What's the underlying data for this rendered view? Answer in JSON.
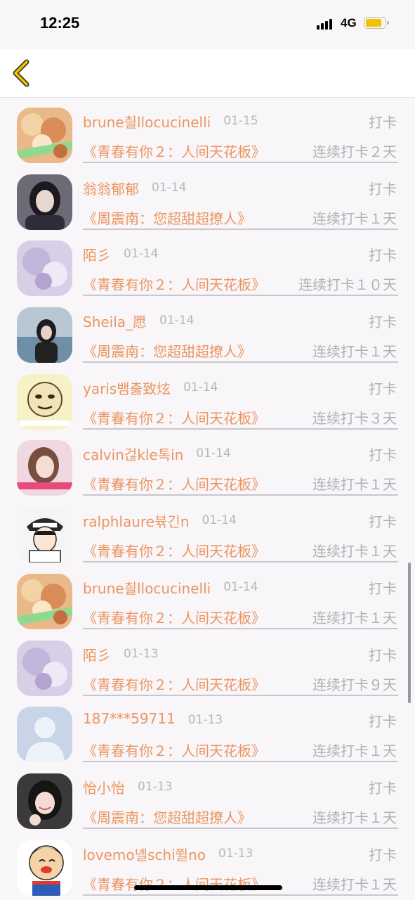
{
  "status_bar": {
    "time": "12:25",
    "network": "4G"
  },
  "nav": {
    "back_icon": "chevron-left-icon",
    "accent": "#f2c200"
  },
  "colors": {
    "name": "#ec9560",
    "muted": "#b3b0b4"
  },
  "entries": [
    {
      "name": "brune칄llocucinelli",
      "date": "01-15",
      "action": "打卡",
      "book": "《青春有你２：人间天花板》",
      "streak": "连续打卡２天",
      "avatar": "flowers"
    },
    {
      "name": "翁翁郁郁",
      "date": "01-14",
      "action": "打卡",
      "book": "《周震南：您超甜超撩人》",
      "streak": "连续打卡１天",
      "avatar": "girl-dark"
    },
    {
      "name": "陌彡",
      "date": "01-14",
      "action": "打卡",
      "book": "《青春有你２：人间天花板》",
      "streak": "连续打卡１０天",
      "avatar": "lilac"
    },
    {
      "name": "Sheila_愿",
      "date": "01-14",
      "action": "打卡",
      "book": "《周震南：您超甜超撩人》",
      "streak": "连续打卡１天",
      "avatar": "girl-sea"
    },
    {
      "name": "yaris뱀춣致炫",
      "date": "01-14",
      "action": "打卡",
      "book": "《青春有你２：人间天花板》",
      "streak": "连续打卡３天",
      "avatar": "meme"
    },
    {
      "name": "calvin걶kle톡in",
      "date": "01-14",
      "action": "打卡",
      "book": "《青春有你２：人间天花板》",
      "streak": "连续打卡１天",
      "avatar": "girl-pink"
    },
    {
      "name": "ralphlaure뷲긴n",
      "date": "01-14",
      "action": "打卡",
      "book": "《青春有你２：人间天花板》",
      "streak": "连续打卡１天",
      "avatar": "anime"
    },
    {
      "name": "brune칄llocucinelli",
      "date": "01-14",
      "action": "打卡",
      "book": "《青春有你２：人间天花板》",
      "streak": "连续打卡１天",
      "avatar": "flowers"
    },
    {
      "name": "陌彡",
      "date": "01-13",
      "action": "打卡",
      "book": "《青春有你２：人间天花板》",
      "streak": "连续打卡９天",
      "avatar": "lilac"
    },
    {
      "name": "187***59711",
      "date": "01-13",
      "action": "打卡",
      "book": "《青春有你２：人间天花板》",
      "streak": "连续打卡１天",
      "avatar": "default"
    },
    {
      "name": "怡小怡",
      "date": "01-13",
      "action": "打卡",
      "book": "《周震南：您超甜超撩人》",
      "streak": "连续打卡１天",
      "avatar": "girl-smile"
    },
    {
      "name": "lovemo녤schi쮤no",
      "date": "01-13",
      "action": "打卡",
      "book": "《青春有你２：人间天花板》",
      "streak": "连续打卡１天",
      "avatar": "cartoon"
    }
  ]
}
